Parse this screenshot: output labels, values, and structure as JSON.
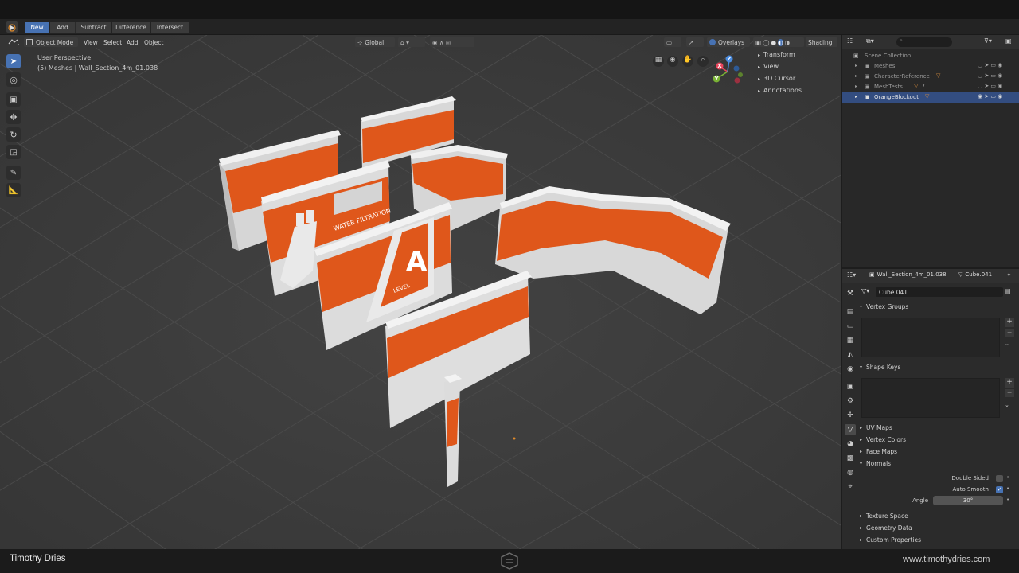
{
  "boolean_bar": {
    "new": "New",
    "add": "Add",
    "subtract": "Subtract",
    "difference": "Difference",
    "intersect": "Intersect"
  },
  "viewport_header": {
    "mode": "Object Mode",
    "view": "View",
    "select": "Select",
    "add": "Add",
    "object": "Object",
    "orientation": "Global",
    "overlays": "Overlays",
    "shading": "Shading"
  },
  "viewport_info": {
    "perspective": "User Perspective",
    "selection": "(5) Meshes | Wall_Section_4m_01.038"
  },
  "n_panel_tabs": [
    "Transform",
    "View",
    "3D Cursor",
    "Annotations"
  ],
  "gizmo": {
    "x": "X",
    "y": "Y",
    "z": "Z"
  },
  "wall_signs": {
    "sign_text": "WATER FILTRATION",
    "level_letter": "A",
    "level_word": "LEVEL"
  },
  "outliner": {
    "search_placeholder": "",
    "root": "Scene Collection",
    "collections": [
      {
        "name": "Meshes",
        "selected": false
      },
      {
        "name": "CharacterReference",
        "selected": false
      },
      {
        "name": "MeshTests",
        "selected": false
      },
      {
        "name": "OrangeBlockout",
        "selected": true
      }
    ],
    "mesh_tests_badge": "7"
  },
  "properties": {
    "object_name": "Wall_Section_4m_01.038",
    "data_name": "Cube.041",
    "mesh_field": "Cube.041",
    "panels": {
      "vertex_groups": "Vertex Groups",
      "shape_keys": "Shape Keys",
      "uv_maps": "UV Maps",
      "vertex_colors": "Vertex Colors",
      "face_maps": "Face Maps",
      "normals": "Normals",
      "double_sided": "Double Sided",
      "auto_smooth": "Auto Smooth",
      "angle_label": "Angle",
      "angle_value": "30°",
      "texture_space": "Texture Space",
      "geometry_data": "Geometry Data",
      "custom_properties": "Custom Properties"
    }
  },
  "footer": {
    "author": "Timothy Dries",
    "website": "www.timothydries.com"
  },
  "colors": {
    "accent": "#4772b3",
    "wall_orange": "#e0581b",
    "wall_white": "#dcdcdc",
    "viewport_bg": "#3a3a3a",
    "grid_line": "#454545"
  }
}
